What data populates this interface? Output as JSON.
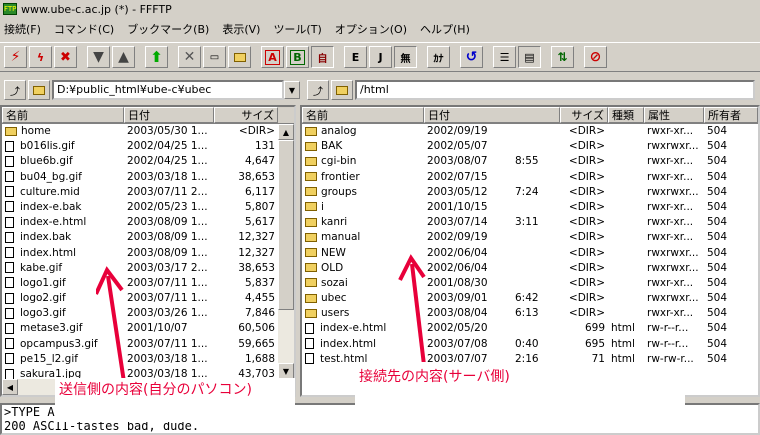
{
  "window": {
    "title": "www.ube-c.ac.jp (*) - FFFTP"
  },
  "menu": [
    "接続(F)",
    "コマンド(C)",
    "ブックマーク(B)",
    "表示(V)",
    "ツール(T)",
    "オプション(O)",
    "ヘルプ(H)"
  ],
  "toolbar": {
    "ascii": "A",
    "binary": "B",
    "auto": "自",
    "euc": "E",
    "jis": "J",
    "nochange": "無",
    "kana": "ｶﾅ"
  },
  "local": {
    "path": "D:¥public_html¥ube-c¥ubec",
    "columns": [
      "名前",
      "日付",
      "サイズ"
    ],
    "rows": [
      {
        "type": "folder",
        "name": "home",
        "date": "2003/05/30 1...",
        "size": "<DIR>"
      },
      {
        "type": "file",
        "name": "b016lis.gif",
        "date": "2002/04/25 1...",
        "size": "131"
      },
      {
        "type": "file",
        "name": "blue6b.gif",
        "date": "2002/04/25 1...",
        "size": "4,647"
      },
      {
        "type": "file",
        "name": "bu04_bg.gif",
        "date": "2003/03/18 1...",
        "size": "38,653"
      },
      {
        "type": "file",
        "name": "culture.mid",
        "date": "2003/07/11 2...",
        "size": "6,117"
      },
      {
        "type": "file",
        "name": "index-e.bak",
        "date": "2002/05/23 1...",
        "size": "5,807"
      },
      {
        "type": "file",
        "name": "index-e.html",
        "date": "2003/08/09 1...",
        "size": "5,617"
      },
      {
        "type": "file",
        "name": "index.bak",
        "date": "2003/08/09 1...",
        "size": "12,327"
      },
      {
        "type": "file",
        "name": "index.html",
        "date": "2003/08/09 1...",
        "size": "12,327"
      },
      {
        "type": "file",
        "name": "kabe.gif",
        "date": "2003/03/17 2...",
        "size": "38,653"
      },
      {
        "type": "file",
        "name": "logo1.gif",
        "date": "2003/07/11 1...",
        "size": "5,837"
      },
      {
        "type": "file",
        "name": "logo2.gif",
        "date": "2003/07/11 1...",
        "size": "4,455"
      },
      {
        "type": "file",
        "name": "logo3.gif",
        "date": "2003/03/26 1...",
        "size": "7,846"
      },
      {
        "type": "file",
        "name": "metase3.gif",
        "date": "2001/10/07",
        "size": "60,506"
      },
      {
        "type": "file",
        "name": "opcampus3.gif",
        "date": "2003/07/11 1...",
        "size": "59,665"
      },
      {
        "type": "file",
        "name": "pe15_l2.gif",
        "date": "2003/03/18 1...",
        "size": "1,688"
      },
      {
        "type": "file",
        "name": "sakura1.jpg",
        "date": "2003/03/18 1...",
        "size": "43,703"
      }
    ]
  },
  "remote": {
    "path": "/html",
    "columns": [
      "名前",
      "日付",
      "サイズ",
      "種類",
      "属性",
      "所有者"
    ],
    "rows": [
      {
        "type": "folder",
        "name": "analog",
        "date": "2002/09/19",
        "time": "",
        "size": "<DIR>",
        "kind": "",
        "attr": "rwxr-xr...",
        "owner": "504"
      },
      {
        "type": "folder",
        "name": "BAK",
        "date": "2002/05/07",
        "time": "",
        "size": "<DIR>",
        "kind": "",
        "attr": "rwxrwxr...",
        "owner": "504"
      },
      {
        "type": "folder",
        "name": "cgi-bin",
        "date": "2003/08/07",
        "time": "8:55",
        "size": "<DIR>",
        "kind": "",
        "attr": "rwxr-xr...",
        "owner": "504"
      },
      {
        "type": "folder",
        "name": "frontier",
        "date": "2002/07/15",
        "time": "",
        "size": "<DIR>",
        "kind": "",
        "attr": "rwxr-xr...",
        "owner": "504"
      },
      {
        "type": "folder",
        "name": "groups",
        "date": "2003/05/12",
        "time": "7:24",
        "size": "<DIR>",
        "kind": "",
        "attr": "rwxrwxr...",
        "owner": "504"
      },
      {
        "type": "folder",
        "name": "i",
        "date": "2001/10/15",
        "time": "",
        "size": "<DIR>",
        "kind": "",
        "attr": "rwxr-xr...",
        "owner": "504"
      },
      {
        "type": "folder",
        "name": "kanri",
        "date": "2003/07/14",
        "time": "3:11",
        "size": "<DIR>",
        "kind": "",
        "attr": "rwxr-xr...",
        "owner": "504"
      },
      {
        "type": "folder",
        "name": "manual",
        "date": "2002/09/19",
        "time": "",
        "size": "<DIR>",
        "kind": "",
        "attr": "rwxr-xr...",
        "owner": "504"
      },
      {
        "type": "folder",
        "name": "NEW",
        "date": "2002/06/04",
        "time": "",
        "size": "<DIR>",
        "kind": "",
        "attr": "rwxrwxr...",
        "owner": "504"
      },
      {
        "type": "folder",
        "name": "OLD",
        "date": "2002/06/04",
        "time": "",
        "size": "<DIR>",
        "kind": "",
        "attr": "rwxrwxr...",
        "owner": "504"
      },
      {
        "type": "folder",
        "name": "sozai",
        "date": "2001/08/30",
        "time": "",
        "size": "<DIR>",
        "kind": "",
        "attr": "rwxr-xr...",
        "owner": "504"
      },
      {
        "type": "folder",
        "name": "ubec",
        "date": "2003/09/01",
        "time": "6:42",
        "size": "<DIR>",
        "kind": "",
        "attr": "rwxrwxr...",
        "owner": "504"
      },
      {
        "type": "folder",
        "name": "users",
        "date": "2003/08/04",
        "time": "6:13",
        "size": "<DIR>",
        "kind": "",
        "attr": "rwxr-xr...",
        "owner": "504"
      },
      {
        "type": "file",
        "name": "index-e.html",
        "date": "2002/05/20",
        "time": "",
        "size": "699",
        "kind": "html",
        "attr": "rw-r--r...",
        "owner": "504"
      },
      {
        "type": "file",
        "name": "index.html",
        "date": "2003/07/08",
        "time": "0:40",
        "size": "695",
        "kind": "html",
        "attr": "rw-r--r...",
        "owner": "504"
      },
      {
        "type": "file",
        "name": "test.html",
        "date": "2003/07/07",
        "time": "2:16",
        "size": "71",
        "kind": "html",
        "attr": "rw-rw-r...",
        "owner": "504"
      }
    ]
  },
  "log": [
    ">TYPE A",
    "200 ASCII-tastes bad, dude."
  ],
  "annotations": {
    "left": "送信側の内容(自分のパソコン)",
    "right": "接続先の内容(サーバ側)"
  },
  "colors": {
    "annotation": "#e8003a"
  }
}
